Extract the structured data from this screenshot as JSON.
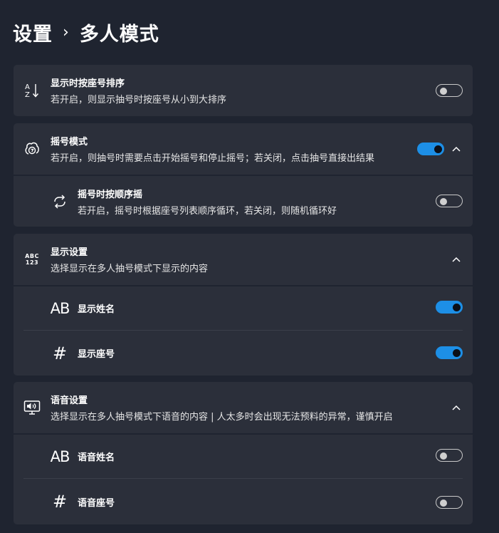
{
  "breadcrumb": {
    "parent": "设置",
    "separator": "›",
    "current": "多人模式"
  },
  "cards": {
    "sort": {
      "icon": "sort-az-icon",
      "title": "显示时按座号排序",
      "desc": "若开启，则显示抽号时按座号从小到大排序",
      "enabled": false
    },
    "shake": {
      "icon": "shake-icon",
      "title": "摇号模式",
      "desc": "若开启，则抽号时需要点击开始摇号和停止摇号；若关闭，点击抽号直接出结果",
      "enabled": true,
      "sub": {
        "icon": "loop-icon",
        "title": "摇号时按顺序摇",
        "desc": "若开启，摇号时根据座号列表顺序循环，若关闭，则随机循环好",
        "enabled": false
      }
    },
    "display": {
      "icon": "abc-123-icon",
      "icon_text_top": "ABC",
      "icon_text_bottom": "123",
      "title": "显示设置",
      "desc": "选择显示在多人抽号模式下显示的内容",
      "items": [
        {
          "icon_text": "AB",
          "label": "显示姓名",
          "enabled": true
        },
        {
          "icon_text": "#",
          "label": "显示座号",
          "enabled": true
        }
      ]
    },
    "voice": {
      "icon": "speaker-screen-icon",
      "title": "语音设置",
      "desc": "选择显示在多人抽号模式下语音的内容 | 人太多时会出现无法预料的异常，谨慎开启",
      "items": [
        {
          "icon_text": "AB",
          "label": "语音姓名",
          "enabled": false
        },
        {
          "icon_text": "#",
          "label": "语音座号",
          "enabled": false
        }
      ]
    }
  },
  "colors": {
    "accent": "#1d8fe6",
    "card": "#2b2f3a",
    "background": "#1f2430"
  }
}
